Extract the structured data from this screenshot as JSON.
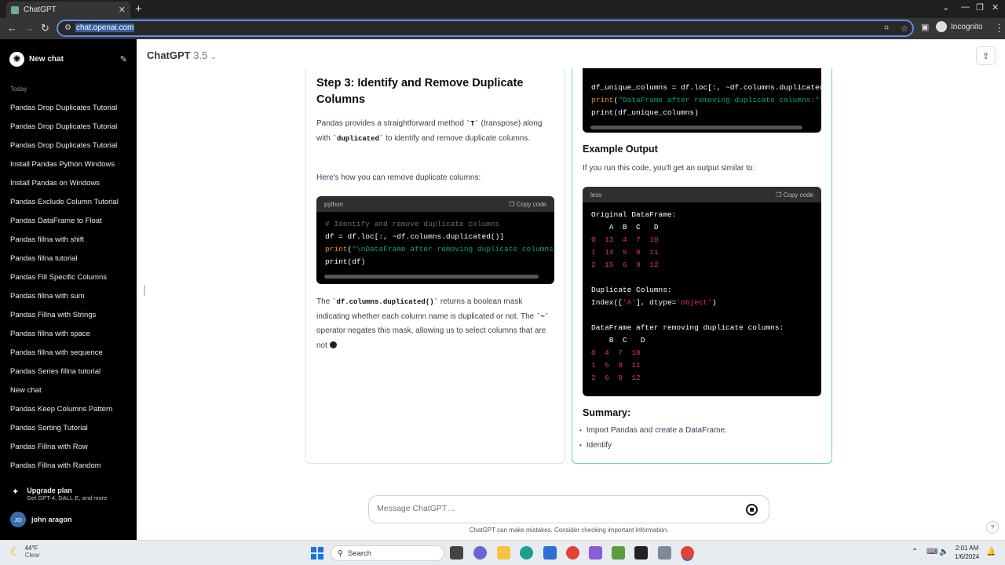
{
  "browser": {
    "tab_title": "ChatGPT",
    "url": "chat.openai.com",
    "incognito_label": "Incognito"
  },
  "sidebar": {
    "new_chat": "New chat",
    "section_today": "Today",
    "history": [
      "Pandas Drop Duplicates Tutorial",
      "Pandas Drop Duplicates Tutorial",
      "Pandas Drop Duplicates Tutorial",
      "Install Pandas Python Windows",
      "Install Pandas on Windows",
      "Pandas Exclude Column Tutorial",
      "Pandas DataFrame to Float",
      "Pandas fillna with shift",
      "Pandas fillna tutorial",
      "Pandas Fill Specific Columns",
      "Pandas fillna with sum",
      "Pandas Fillna with Strings",
      "Pandas fillna with space",
      "Pandas fillna with sequence",
      "Pandas Series fillna tutorial",
      "New chat",
      "Pandas Keep Columns Pattern",
      "Pandas Sorting Tutorial",
      "Pandas Fillna with Row",
      "Pandas Fillna with Random"
    ],
    "upgrade_title": "Upgrade plan",
    "upgrade_sub": "Get GPT-4, DALL·E, and more",
    "user_initials": "JO",
    "user_name": "john aragon"
  },
  "header": {
    "model": "ChatGPT",
    "version": "3.5"
  },
  "left_panel": {
    "heading": "Step 3: Identify and Remove Duplicate Columns",
    "p1_a": "Pandas provides a straightforward method ",
    "p1_code1": "`T`",
    "p1_b": " (transpose) along with ",
    "p1_code2": "`duplicated`",
    "p1_c": " to identify and remove duplicate columns.",
    "p2": "Here's how you can remove duplicate columns:",
    "code_lang": "python",
    "copy_label": "Copy code",
    "code_line1": "# Identify and remove duplicate columns",
    "code_line2": "df = df.loc[:, ~df.columns.duplicated()]",
    "code_line3_fn": "print",
    "code_line3_str": "\"\\nDataFrame after removing duplicate columns:",
    "code_line4": "print(df)",
    "p3_a": "The ",
    "p3_code1": "`df.columns.duplicated()`",
    "p3_b": " returns a boolean mask indicating whether each column name is duplicated or not. The ",
    "p3_code2": "`~`",
    "p3_c": " operator negates this mask, allowing us to select columns that are not"
  },
  "right_panel": {
    "top_code_line1": "df_unique_columns = df.loc[:, ~df.columns.duplicated",
    "top_code_line2_fn": "print",
    "top_code_line2_str": "\"DataFrame after removing duplicate columns:\"",
    "top_code_line3": "print(df_unique_columns)",
    "heading_output": "Example Output",
    "p_output": "If you run this code, you'll get an output similar to:",
    "out_lang": "less",
    "copy_label": "Copy code",
    "heading_summary": "Summary:",
    "bullets": [
      "Import Pandas and create a DataFrame.",
      "Identify"
    ]
  },
  "composer": {
    "placeholder": "Message ChatGPT…",
    "disclaimer": "ChatGPT can make mistakes. Consider checking important information."
  },
  "taskbar": {
    "temp": "44°F",
    "condition": "Clear",
    "search": "Search",
    "time": "2:01 AM",
    "date": "1/6/2024"
  }
}
